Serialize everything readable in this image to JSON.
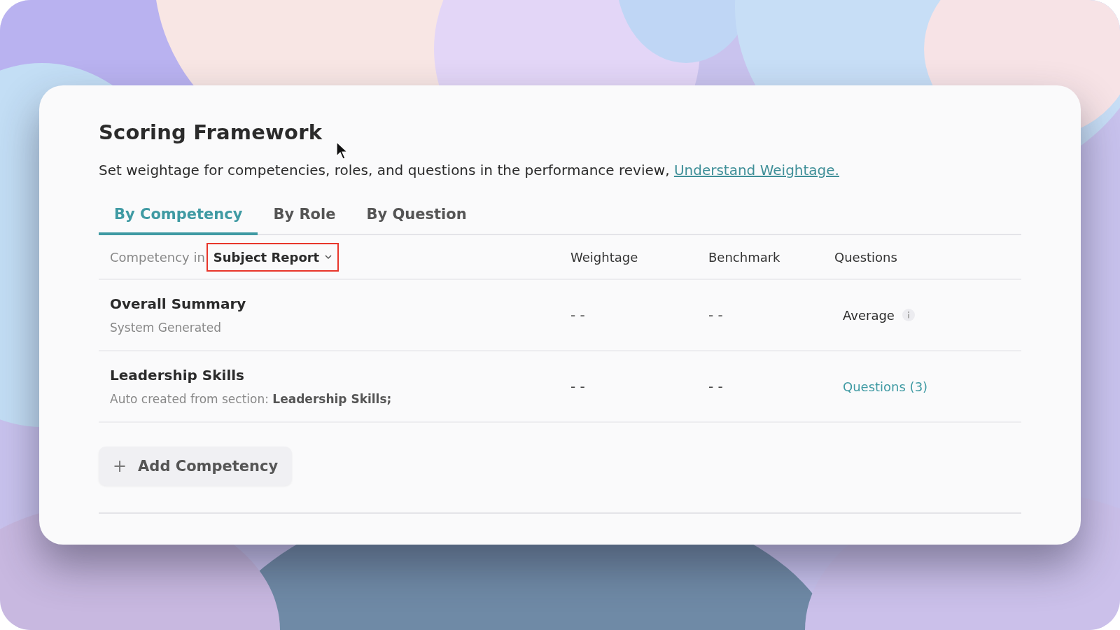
{
  "card": {
    "title": "Scoring Framework",
    "description": "Set weightage for competencies, roles, and questions in the performance review, ",
    "description_link": "Understand Weightage.",
    "tabs": [
      {
        "label": "By Competency",
        "selected": true
      },
      {
        "label": "By Role",
        "selected": false
      },
      {
        "label": "By Question",
        "selected": false
      }
    ],
    "table": {
      "first_column_prefix": "Competency in",
      "report_dropdown": {
        "value": "Subject Report",
        "highlighted": true
      },
      "columns": [
        "Weightage",
        "Benchmark",
        "Questions"
      ],
      "rows": [
        {
          "name": "Overall Summary",
          "subtitle": "System Generated",
          "weightage": "- -",
          "benchmark": "- -",
          "questions": "Average",
          "kind": "info"
        },
        {
          "name": "Leadership Skills",
          "subtitle": "Auto created from section: **Leadership Skills;**",
          "weightage": "- -",
          "benchmark": "- -",
          "questions": "Questions (3)",
          "kind": "link"
        }
      ]
    },
    "add_button": {
      "icon": "+",
      "label": "Add Competency"
    }
  }
}
